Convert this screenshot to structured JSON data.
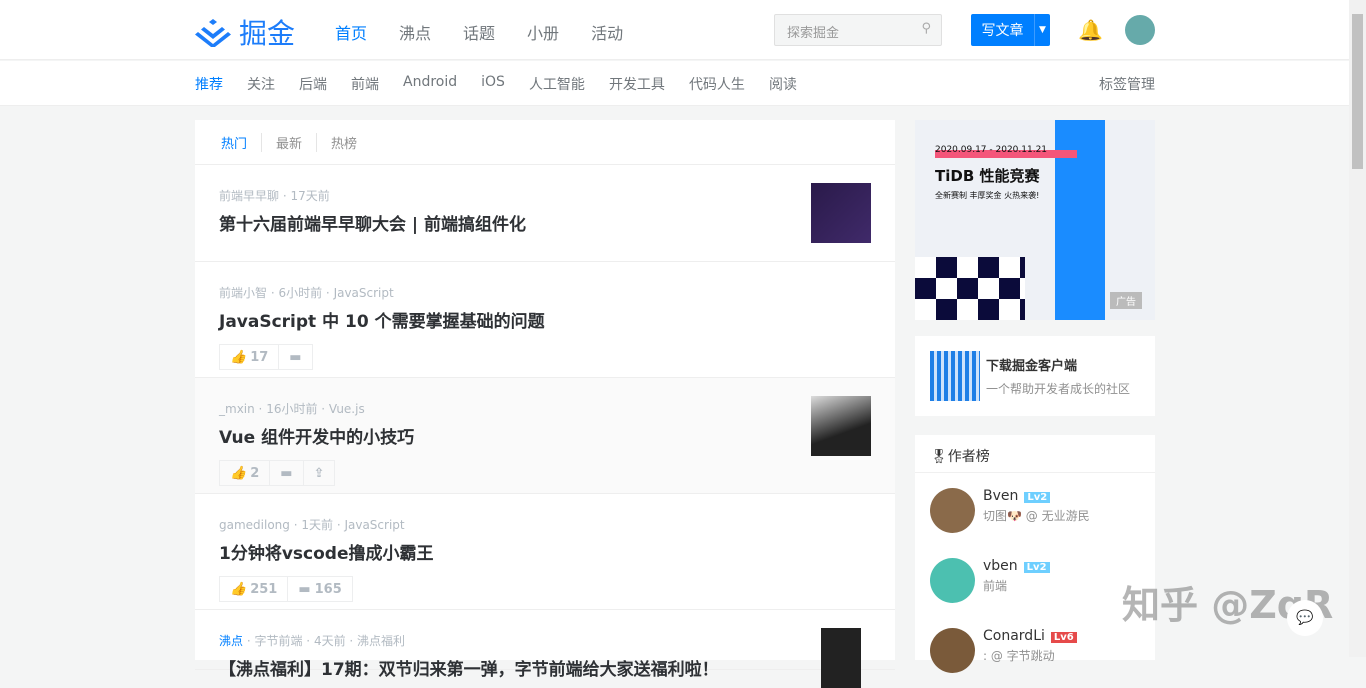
{
  "header": {
    "logo": "掘金",
    "nav": [
      "首页",
      "沸点",
      "话题",
      "小册",
      "活动"
    ],
    "search_placeholder": "探索掘金",
    "write_label": "写文章"
  },
  "subnav": {
    "items": [
      "推荐",
      "关注",
      "后端",
      "前端",
      "Android",
      "iOS",
      "人工智能",
      "开发工具",
      "代码人生",
      "阅读"
    ],
    "tag_manage": "标签管理"
  },
  "tabs": [
    "热门",
    "最新",
    "热榜"
  ],
  "articles": [
    {
      "author": "前端早早聊",
      "time": "17天前",
      "tag": "",
      "title": "第十六届前端早早聊大会 | 前端搞组件化",
      "likes": "",
      "comments": ""
    },
    {
      "author": "前端小智",
      "time": "6小时前",
      "tag": "JavaScript",
      "title": "JavaScript 中 10 个需要掌握基础的问题",
      "likes": "17",
      "comments": ""
    },
    {
      "author": "_mxin",
      "time": "16小时前",
      "tag": "Vue.js",
      "title": "Vue 组件开发中的小技巧",
      "likes": "2",
      "comments": ""
    },
    {
      "author": "gamedilong",
      "time": "1天前",
      "tag": "JavaScript",
      "title": "1分钟将vscode撸成小霸王",
      "likes": "251",
      "comments": "165"
    },
    {
      "category": "沸点",
      "author": "字节前端",
      "time": "4天前",
      "tag": "沸点福利",
      "title": "【沸点福利】17期：双节归来第一弹，字节前端给大家送福利啦！"
    }
  ],
  "ad": {
    "dates": "2020.09.17 - 2020.11.21",
    "title": "TiDB 性能竞赛",
    "subtitle": "全新赛制 丰厚奖金 火热来袭!",
    "badge": "广告"
  },
  "download": {
    "title": "下载掘金客户端",
    "subtitle": "一个帮助开发者成长的社区"
  },
  "rank": {
    "title": "作者榜",
    "authors": [
      {
        "name": "Bven",
        "level": "Lv2",
        "desc": "切图🐶 @ 无业游民"
      },
      {
        "name": "vben",
        "level": "Lv2",
        "desc": "前端"
      },
      {
        "name": "ConardLi",
        "level": "Lv6",
        "desc": ": @ 字节跳动"
      }
    ]
  },
  "watermark": "知乎 @ZqR"
}
